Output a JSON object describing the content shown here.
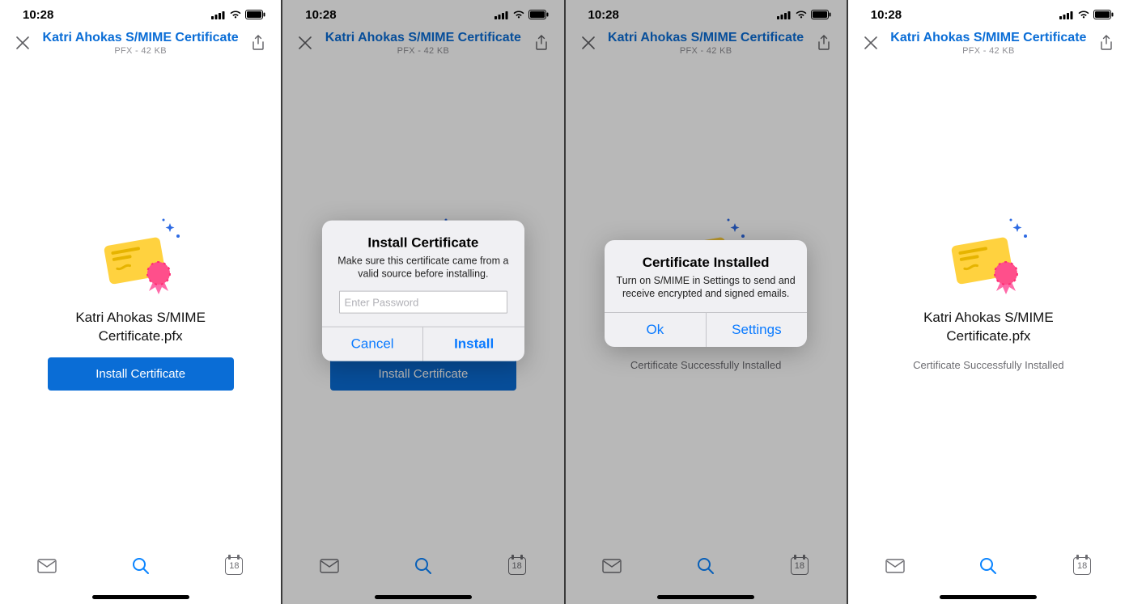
{
  "statusbar": {
    "time": "10:28"
  },
  "header": {
    "title": "Katri Ahokas S/MIME Certificate",
    "subtitle": "PFX - 42 KB"
  },
  "certificate": {
    "filename": "Katri Ahokas S/MIME Certificate.pfx",
    "install_label": "Install Certificate",
    "installed_label": "Certificate Successfully Installed"
  },
  "alerts": {
    "install": {
      "title": "Install Certificate",
      "message": "Make sure this certificate came from a valid source before installing.",
      "placeholder": "Enter Password",
      "cancel": "Cancel",
      "confirm": "Install"
    },
    "installed": {
      "title": "Certificate Installed",
      "message": "Turn on S/MIME in Settings to send and receive encrypted and signed emails.",
      "ok": "Ok",
      "settings": "Settings"
    }
  },
  "tabbar": {
    "calendar_day": "18"
  }
}
